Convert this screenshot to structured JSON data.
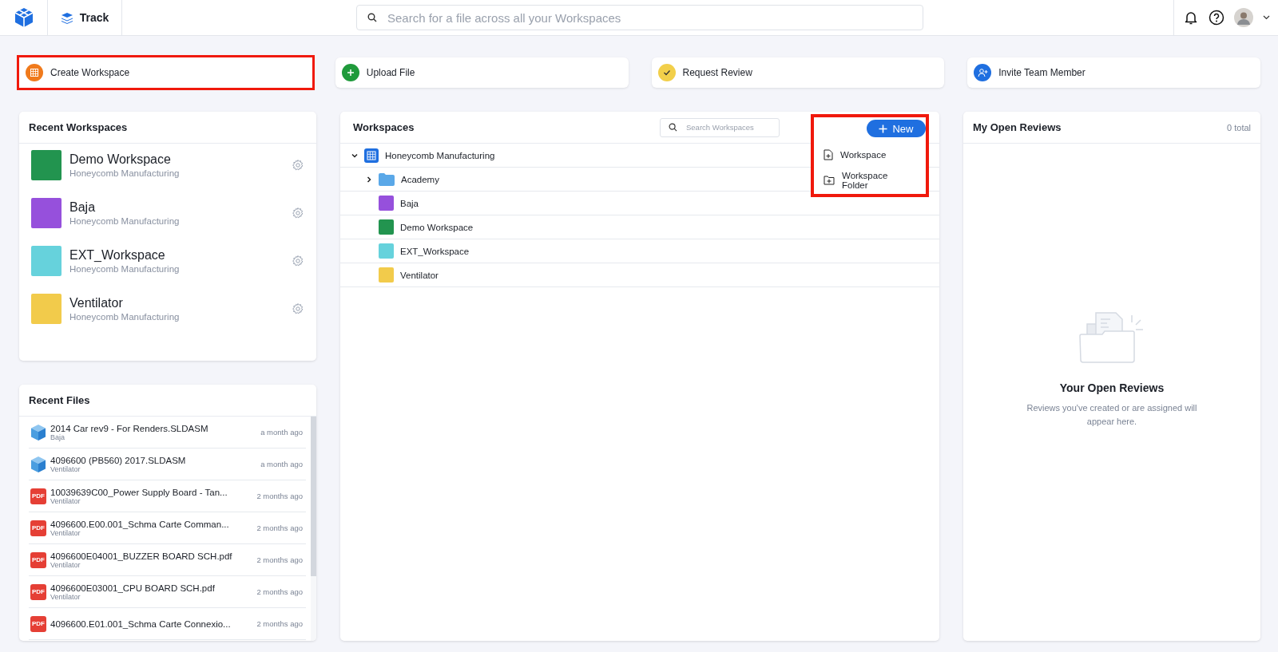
{
  "header": {
    "app_name": "Track",
    "search": {
      "placeholder": "Search for a file across all your Workspaces"
    }
  },
  "actions": [
    {
      "label": "Create Workspace",
      "kind": "workspace",
      "color": "#f07a1c",
      "highlighted": true
    },
    {
      "label": "Upload File",
      "kind": "upload",
      "color": "#1f9a3b",
      "highlighted": false
    },
    {
      "label": "Request Review",
      "kind": "review",
      "color": "#f2cf4a",
      "highlighted": false
    },
    {
      "label": "Invite Team Member",
      "kind": "invite",
      "color": "#1f6fe0",
      "highlighted": false
    }
  ],
  "recent_workspaces": {
    "title": "Recent Workspaces",
    "items": [
      {
        "name": "Demo Workspace",
        "org": "Honeycomb Manufacturing",
        "color": "#22944f"
      },
      {
        "name": "Baja",
        "org": "Honeycomb Manufacturing",
        "color": "#9650dc"
      },
      {
        "name": "EXT_Workspace",
        "org": "Honeycomb Manufacturing",
        "color": "#66d2dc"
      },
      {
        "name": "Ventilator",
        "org": "Honeycomb Manufacturing",
        "color": "#f2cb4b"
      }
    ]
  },
  "recent_files": {
    "title": "Recent Files",
    "items": [
      {
        "name": "2014 Car rev9 - For Renders.SLDASM",
        "workspace": "Baja",
        "time": "a month ago",
        "kind": "cad"
      },
      {
        "name": "4096600 (PB560) 2017.SLDASM",
        "workspace": "Ventilator",
        "time": "a month ago",
        "kind": "cad"
      },
      {
        "name": "10039639C00_Power Supply Board - Tan...",
        "workspace": "Ventilator",
        "time": "2 months ago",
        "kind": "pdf",
        "icon_text": "PDF"
      },
      {
        "name": "4096600.E00.001_Schma Carte Comman...",
        "workspace": "Ventilator",
        "time": "2 months ago",
        "kind": "pdf",
        "icon_text": "PDF"
      },
      {
        "name": "4096600E04001_BUZZER BOARD SCH.pdf",
        "workspace": "Ventilator",
        "time": "2 months ago",
        "kind": "pdf",
        "icon_text": "PDF"
      },
      {
        "name": "4096600E03001_CPU BOARD SCH.pdf",
        "workspace": "Ventilator",
        "time": "2 months ago",
        "kind": "pdf",
        "icon_text": "PDF"
      },
      {
        "name": "4096600.E01.001_Schma Carte Connexio...",
        "time": "2 months ago",
        "kind": "pdf",
        "icon_text": "PDF"
      }
    ]
  },
  "workspaces": {
    "title": "Workspaces",
    "search": {
      "placeholder": "Search Workspaces"
    },
    "new_button": {
      "label": "New"
    },
    "menu": {
      "highlighted": true,
      "items": [
        {
          "label": "Workspace",
          "kind": "file"
        },
        {
          "label": "Workspace Folder",
          "kind": "folder"
        }
      ]
    },
    "tree": [
      {
        "name": "Honeycomb Manufacturing",
        "kind": "org",
        "expanded": true,
        "children": [
          {
            "name": "Academy",
            "kind": "folder",
            "expanded": false
          },
          {
            "name": "Baja",
            "kind": "workspace",
            "color": "#9650dc"
          },
          {
            "name": "Demo Workspace",
            "kind": "workspace",
            "color": "#22944f"
          },
          {
            "name": "EXT_Workspace",
            "kind": "workspace",
            "color": "#66d2dc"
          },
          {
            "name": "Ventilator",
            "kind": "workspace",
            "color": "#f2cb4b"
          }
        ]
      }
    ]
  },
  "reviews": {
    "title": "My Open Reviews",
    "count": "0 total",
    "empty": {
      "title": "Your Open Reviews",
      "text": "Reviews you've created or are assigned will appear here."
    }
  }
}
